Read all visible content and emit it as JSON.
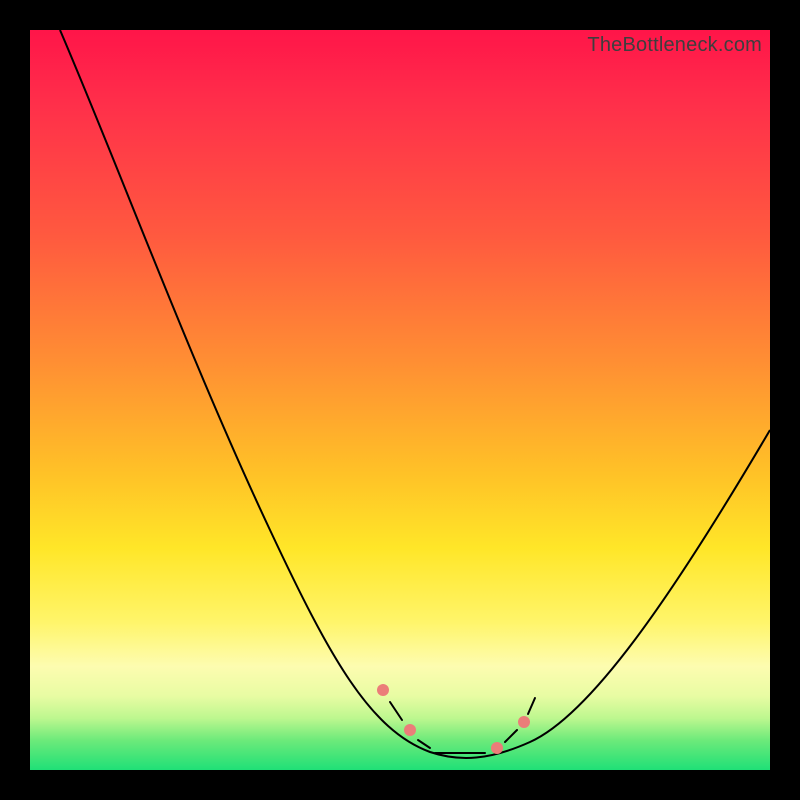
{
  "watermark": "TheBottleneck.com",
  "chart_data": {
    "type": "line",
    "title": "",
    "xlabel": "",
    "ylabel": "",
    "xlim": [
      0,
      100
    ],
    "ylim": [
      0,
      100
    ],
    "grid": false,
    "legend": false,
    "background_gradient": {
      "stops": [
        {
          "pos": 0,
          "color": "#ff1549"
        },
        {
          "pos": 28,
          "color": "#ff5a3f"
        },
        {
          "pos": 60,
          "color": "#ffc227"
        },
        {
          "pos": 80,
          "color": "#fff56a"
        },
        {
          "pos": 93,
          "color": "#bdf78f"
        },
        {
          "pos": 100,
          "color": "#1fe077"
        }
      ]
    },
    "series": [
      {
        "name": "bottleneck-curve",
        "x": [
          4,
          10,
          16,
          22,
          28,
          34,
          40,
          46,
          50,
          54,
          58,
          60,
          64,
          70,
          76,
          82,
          88,
          94,
          100
        ],
        "y": [
          100,
          87,
          74,
          62,
          50,
          39,
          28,
          17,
          9,
          4,
          2,
          2,
          3,
          8,
          16,
          25,
          34,
          43,
          52
        ]
      }
    ],
    "confidence_band": {
      "color": "#eb7d79",
      "segments": [
        {
          "x0": 48,
          "y0": 12,
          "x1": 50,
          "y1": 9
        },
        {
          "x0": 51,
          "y0": 7,
          "x1": 53,
          "y1": 5
        },
        {
          "x0": 54,
          "y0": 3,
          "x1": 62,
          "y1": 3
        },
        {
          "x0": 63,
          "y0": 4,
          "x1": 65,
          "y1": 6
        },
        {
          "x0": 66,
          "y0": 8,
          "x1": 67,
          "y1": 11
        }
      ]
    }
  }
}
